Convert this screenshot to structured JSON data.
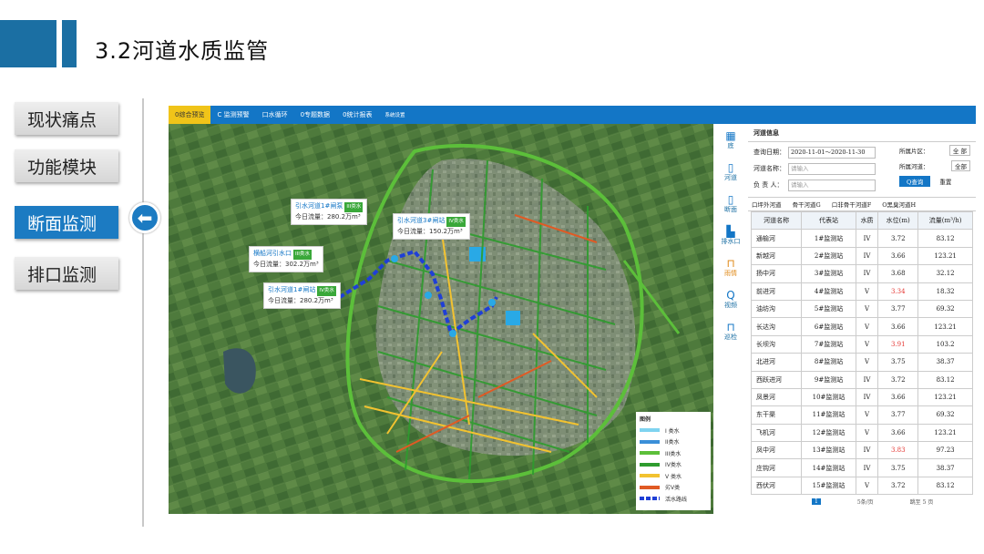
{
  "slide": {
    "title": "3.2河道水质监管"
  },
  "sidebar": {
    "items": [
      {
        "label": "现状痛点"
      },
      {
        "label": "功能模块"
      },
      {
        "label": "断面监测"
      },
      {
        "label": "排口监测"
      }
    ]
  },
  "app": {
    "tabs": [
      {
        "label": "0综合预览"
      },
      {
        "label": "C 监测预警"
      },
      {
        "label": "口水循环"
      },
      {
        "label": "0专题数据"
      },
      {
        "label": "0统计报表"
      },
      {
        "label": "系统设置"
      }
    ],
    "tools": [
      {
        "label": "底",
        "icon": "layers-icon"
      },
      {
        "label": "河道",
        "icon": "phone-icon"
      },
      {
        "label": "断面",
        "icon": "phone-icon"
      },
      {
        "label": "排水口",
        "icon": "outlet-icon"
      },
      {
        "label": "雨情",
        "icon": "rain-icon"
      },
      {
        "label": "视频",
        "icon": "search-icon"
      },
      {
        "label": "巡检",
        "icon": "inspect-icon"
      }
    ],
    "map_labels": [
      {
        "name": "引水河道1#闸泵",
        "badge": "III类水",
        "text": "今日流量：280.2万m³"
      },
      {
        "name": "引水河道3#闸站",
        "badge": "IV类水",
        "text": "今日流量：150.2万m³"
      },
      {
        "name": "横船河引水口",
        "badge": "III类水",
        "text": "今日流量：302.2万m³"
      },
      {
        "name": "引水河道1#闸站",
        "badge": "IV类水",
        "text": "今日流量：280.2万m³"
      }
    ],
    "legend": {
      "title": "图例",
      "items": [
        {
          "label": "I 类水",
          "color": "#7fd3f0"
        },
        {
          "label": "II类水",
          "color": "#3b8fd8"
        },
        {
          "label": "III类水",
          "color": "#5cbf3a"
        },
        {
          "label": "IV类水",
          "color": "#2e9c2e"
        },
        {
          "label": "V 类水",
          "color": "#f2c230"
        },
        {
          "label": "劣V类",
          "color": "#e05a24"
        },
        {
          "label": "活水路线",
          "color": "#1f3fd6"
        }
      ]
    }
  },
  "panel": {
    "section_title": "河道信息",
    "query_date_label": "查询日期：",
    "query_date_value": "2020-11-01～2020-11-30",
    "river_name_label": "河道名称：",
    "river_name_placeholder": "请输入",
    "owner_label": "负 责 人：",
    "owner_placeholder": "请输入",
    "district_label": "所属片区：",
    "district_value": "全 部",
    "level_label": "所属河道：",
    "level_value": "全部",
    "query_button": "Q查询",
    "reset_button": "重置",
    "radios": [
      {
        "label": "口坪外河道"
      },
      {
        "label": "骨干河道G"
      },
      {
        "label": "口非骨干河道F"
      },
      {
        "label": "O黑臭河道H"
      }
    ],
    "columns": [
      "河道名称",
      "代表站",
      "水质",
      "水位(m)",
      "流量(m³/h)"
    ],
    "rows": [
      {
        "name": "通榆河",
        "station": "1#监测站",
        "quality": "IV",
        "level": "3.72",
        "flow": "83.12",
        "alert": false
      },
      {
        "name": "新越河",
        "station": "2#监测站",
        "quality": "IV",
        "level": "3.66",
        "flow": "123.21",
        "alert": false
      },
      {
        "name": "扬中河",
        "station": "3#监测站",
        "quality": "IV",
        "level": "3.68",
        "flow": "32.12",
        "alert": false
      },
      {
        "name": "前进河",
        "station": "4#监测站",
        "quality": "V",
        "level": "3.34",
        "flow": "18.32",
        "alert": true
      },
      {
        "name": "油坊沟",
        "station": "5#监测站",
        "quality": "V",
        "level": "3.77",
        "flow": "69.32",
        "alert": false
      },
      {
        "name": "长达沟",
        "station": "6#监测站",
        "quality": "V",
        "level": "3.66",
        "flow": "123.21",
        "alert": false
      },
      {
        "name": "长坝沟",
        "station": "7#监测站",
        "quality": "V",
        "level": "3.91",
        "flow": "103.2",
        "alert": true
      },
      {
        "name": "北进河",
        "station": "8#监测站",
        "quality": "V",
        "level": "3.75",
        "flow": "38.37",
        "alert": false
      },
      {
        "name": "西跃进河",
        "station": "9#监测站",
        "quality": "IV",
        "level": "3.72",
        "flow": "83.12",
        "alert": false
      },
      {
        "name": "凤景河",
        "station": "10#监测站",
        "quality": "IV",
        "level": "3.66",
        "flow": "123.21",
        "alert": false
      },
      {
        "name": "东干渠",
        "station": "11#监测站",
        "quality": "V",
        "level": "3.77",
        "flow": "69.32",
        "alert": false
      },
      {
        "name": "飞机河",
        "station": "12#监测站",
        "quality": "V",
        "level": "3.66",
        "flow": "123.21",
        "alert": false
      },
      {
        "name": "凤中河",
        "station": "13#监测站",
        "quality": "IV",
        "level": "3.83",
        "flow": "97.23",
        "alert": true
      },
      {
        "name": "庄钩河",
        "station": "14#监测站",
        "quality": "IV",
        "level": "3.75",
        "flow": "38.37",
        "alert": false
      },
      {
        "name": "西伏河",
        "station": "15#监测站",
        "quality": "V",
        "level": "3.72",
        "flow": "83.12",
        "alert": false
      }
    ],
    "pager": {
      "page": "1",
      "per_page": "5条/页",
      "goto": "跳至",
      "goto_page": "5",
      "unit": "页"
    }
  }
}
